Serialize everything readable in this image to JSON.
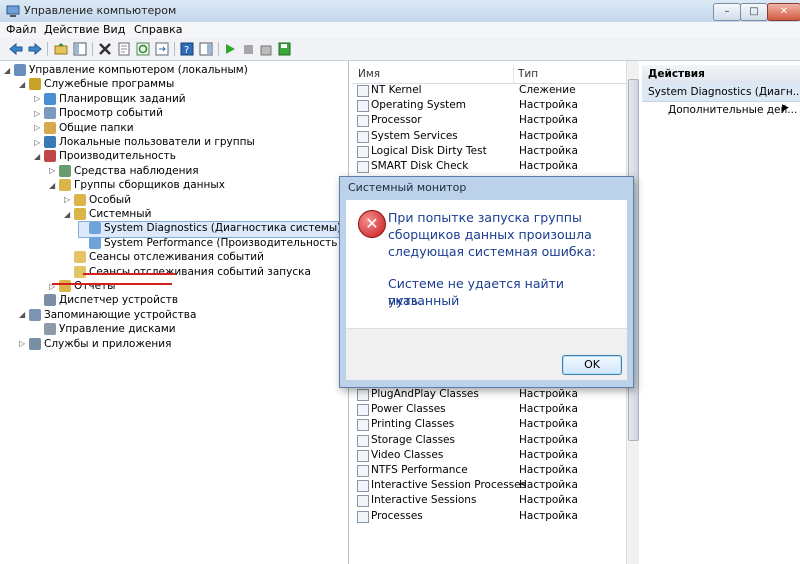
{
  "window": {
    "title": "Управление компьютером",
    "min": "–",
    "max": "□",
    "close": "✕"
  },
  "menu": [
    "Файл",
    "Действие",
    "Вид",
    "Справка"
  ],
  "tree": [
    {
      "label": "Управление компьютером (локальным)",
      "level": 0,
      "expanded": true
    },
    {
      "label": "Служебные программы",
      "level": 1,
      "expanded": true
    },
    {
      "label": "Планировщик заданий",
      "level": 2,
      "expanded": false
    },
    {
      "label": "Просмотр событий",
      "level": 2,
      "expanded": false
    },
    {
      "label": "Общие папки",
      "level": 2,
      "expanded": false
    },
    {
      "label": "Локальные пользователи и группы",
      "level": 2,
      "expanded": false
    },
    {
      "label": "Производительность",
      "level": 2,
      "expanded": true
    },
    {
      "label": "Средства наблюдения",
      "level": 3,
      "expanded": false
    },
    {
      "label": "Группы сборщиков данных",
      "level": 3,
      "expanded": true
    },
    {
      "label": "Особый",
      "level": 4,
      "expanded": false
    },
    {
      "label": "Системный",
      "level": 4,
      "expanded": true
    },
    {
      "label": "System Diagnostics (Диагностика системы)",
      "level": 5,
      "selected": true
    },
    {
      "label": "System Performance (Производительность системы)",
      "level": 5
    },
    {
      "label": "Сеансы отслеживания событий",
      "level": 4
    },
    {
      "label": "Сеансы отслеживания событий запуска",
      "level": 4
    },
    {
      "label": "Отчеты",
      "level": 3,
      "expanded": false
    },
    {
      "label": "Диспетчер устройств",
      "level": 2
    },
    {
      "label": "Запоминающие устройства",
      "level": 1,
      "expanded": true
    },
    {
      "label": "Управление дисками",
      "level": 2
    },
    {
      "label": "Службы и приложения",
      "level": 1,
      "expanded": false
    }
  ],
  "list": {
    "col_name": "Имя",
    "col_type": "Тип",
    "rows_top": [
      {
        "name": "NT Kernel",
        "type": "Слежение"
      },
      {
        "name": "Operating System",
        "type": "Настройка"
      },
      {
        "name": "Processor",
        "type": "Настройка"
      },
      {
        "name": "System Services",
        "type": "Настройка"
      },
      {
        "name": "Logical Disk Dirty Test",
        "type": "Настройка"
      },
      {
        "name": "SMART Disk Check",
        "type": "Настройка"
      }
    ],
    "rows_bottom": [
      {
        "name": "PlugAndPlay Classes",
        "type": "Настройка"
      },
      {
        "name": "Power Classes",
        "type": "Настройка"
      },
      {
        "name": "Printing Classes",
        "type": "Настройка"
      },
      {
        "name": "Storage Classes",
        "type": "Настройка"
      },
      {
        "name": "Video Classes",
        "type": "Настройка"
      },
      {
        "name": "NTFS Performance",
        "type": "Настройка"
      },
      {
        "name": "Interactive Session Processes",
        "type": "Настройка"
      },
      {
        "name": "Interactive Sessions",
        "type": "Настройка"
      },
      {
        "name": "Processes",
        "type": "Настройка"
      }
    ]
  },
  "actions": {
    "header": "Действия",
    "subheader": "System Diagnostics (Диагн...",
    "more": "Дополнительные дей..."
  },
  "dialog": {
    "title": "Системный монитор",
    "message_lines": [
      "При попытке запуска группы",
      "сборщиков данных произошла",
      "следующая системная ошибка:"
    ],
    "detail_lines": [
      "Системе не удается найти указанный",
      "путь."
    ],
    "ok": "OK"
  }
}
